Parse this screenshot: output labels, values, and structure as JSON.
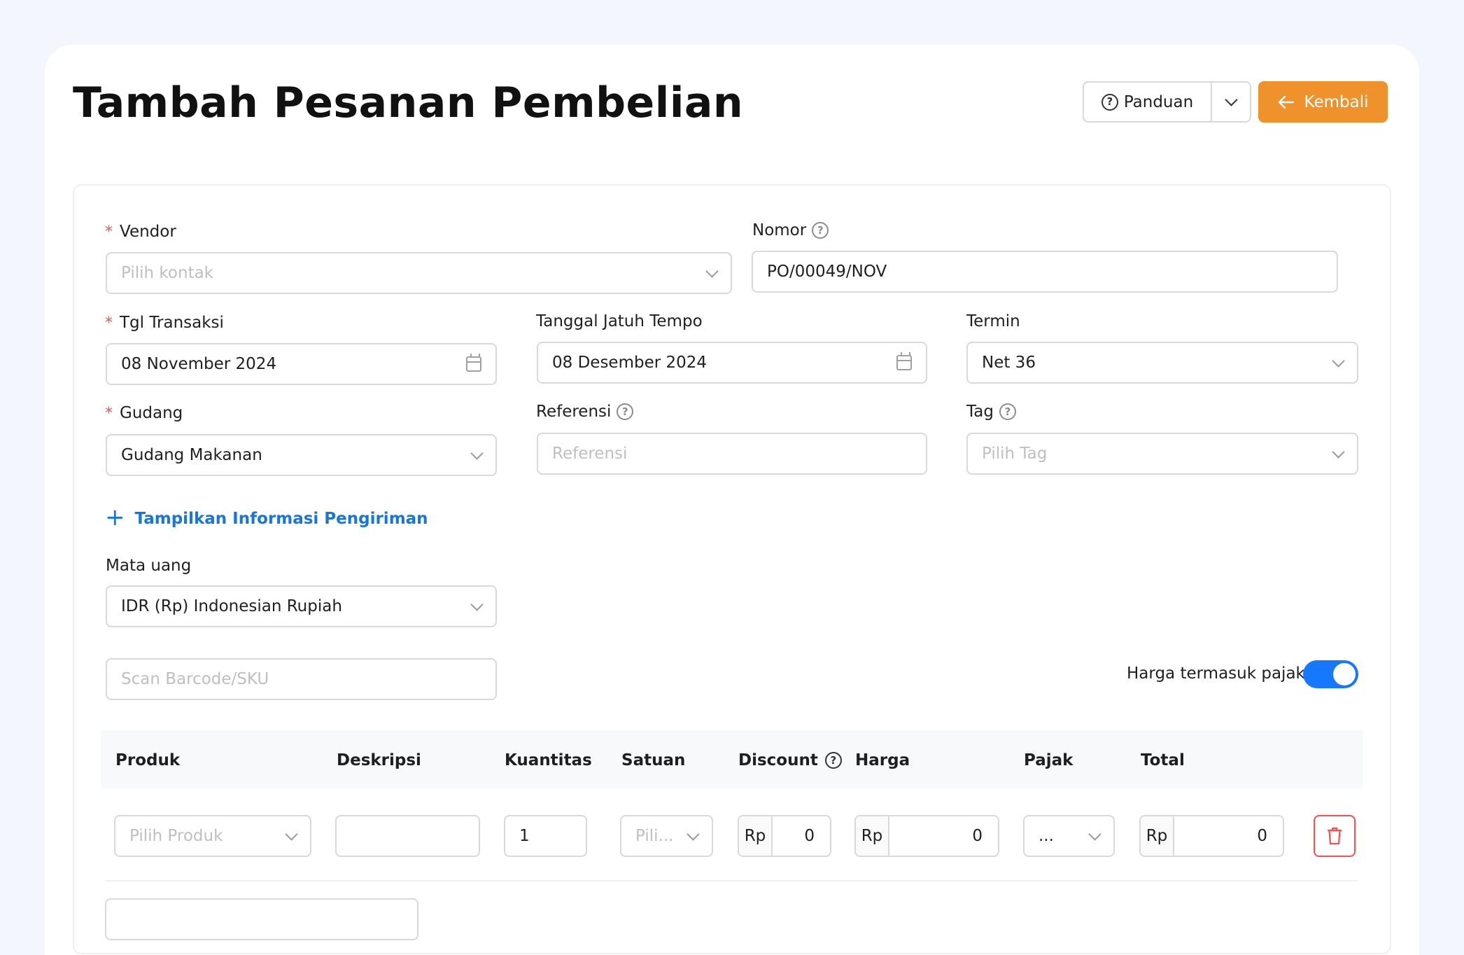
{
  "header": {
    "title": "Tambah Pesanan Pembelian",
    "guide_label": "Panduan",
    "back_label": "Kembali"
  },
  "form": {
    "vendor": {
      "label": "Vendor",
      "placeholder": "Pilih kontak"
    },
    "nomor": {
      "label": "Nomor",
      "value": "PO/00049/NOV"
    },
    "tgl_transaksi": {
      "label": "Tgl Transaksi",
      "value": "08 November 2024"
    },
    "jatuh_tempo": {
      "label": "Tanggal Jatuh Tempo",
      "value": "08 Desember 2024"
    },
    "termin": {
      "label": "Termin",
      "value": "Net 36"
    },
    "gudang": {
      "label": "Gudang",
      "value": "Gudang Makanan"
    },
    "referensi": {
      "label": "Referensi",
      "placeholder": "Referensi"
    },
    "tag": {
      "label": "Tag",
      "placeholder": "Pilih Tag"
    },
    "shipping_link": "Tampilkan Informasi Pengiriman",
    "mata_uang": {
      "label": "Mata uang",
      "value": "IDR (Rp) Indonesian Rupiah"
    },
    "scan": {
      "placeholder": "Scan Barcode/SKU"
    },
    "tax_inclusive": {
      "label": "Harga termasuk pajak",
      "on": true
    }
  },
  "table": {
    "columns": [
      "Produk",
      "Deskripsi",
      "Kuantitas",
      "Satuan",
      "Discount",
      "Harga",
      "Pajak",
      "Total"
    ],
    "row": {
      "produk_placeholder": "Pilih Produk",
      "deskripsi": "",
      "kuantitas": "1",
      "satuan_placeholder": "Pili...",
      "currency": "Rp",
      "discount": "0",
      "harga": "0",
      "pajak": "...",
      "total": "0"
    }
  },
  "colors": {
    "accent_orange": "#f0922b",
    "link_blue": "#1677d8",
    "toggle_blue": "#1677ff",
    "danger_red": "#ff4d4f"
  }
}
